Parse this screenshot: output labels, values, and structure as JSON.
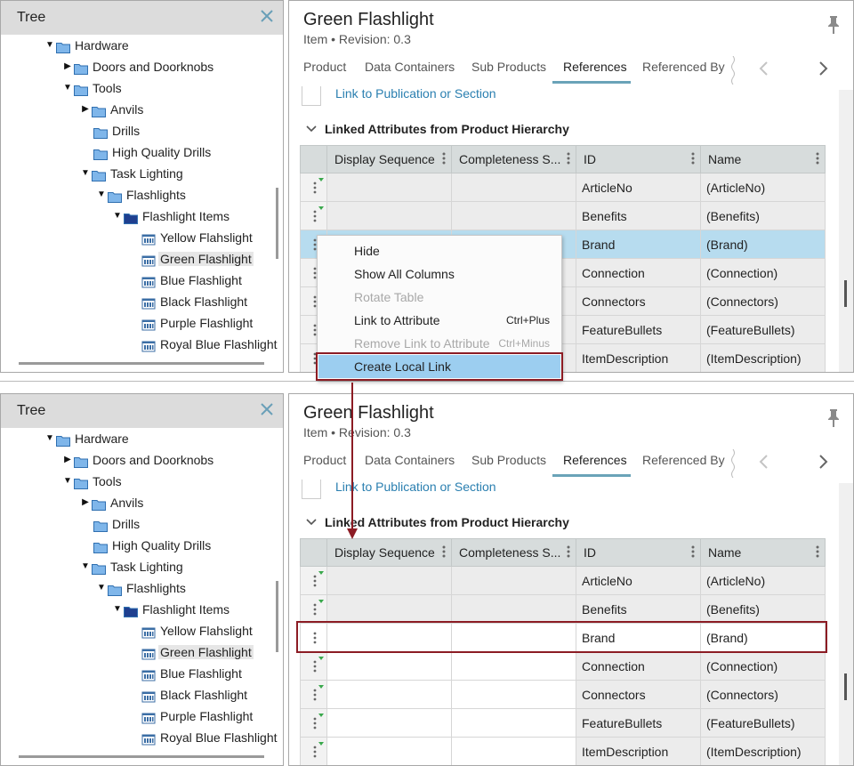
{
  "tree": {
    "title": "Tree",
    "items": [
      {
        "label": "Hardware",
        "arrow": "down",
        "folder": "open"
      },
      {
        "label": "Doors and Doorknobs",
        "arrow": "right",
        "folder": "closed"
      },
      {
        "label": "Tools",
        "arrow": "down",
        "folder": "open"
      },
      {
        "label": "Anvils",
        "arrow": "right",
        "folder": "closed"
      },
      {
        "label": "Drills",
        "arrow": "",
        "folder": "closed"
      },
      {
        "label": "High Quality Drills",
        "arrow": "",
        "folder": "closed"
      },
      {
        "label": "Task Lighting",
        "arrow": "down",
        "folder": "open"
      },
      {
        "label": "Flashlights",
        "arrow": "down",
        "folder": "open"
      },
      {
        "label": "Flashlight Items",
        "arrow": "down",
        "folder": "dark"
      },
      {
        "label": "Yellow Flahslight",
        "arrow": "",
        "folder": "product"
      },
      {
        "label": "Green Flashlight",
        "arrow": "",
        "folder": "product",
        "selected": true
      },
      {
        "label": "Blue Flashlight",
        "arrow": "",
        "folder": "product"
      },
      {
        "label": "Black Flashlight",
        "arrow": "",
        "folder": "product"
      },
      {
        "label": "Purple Flashlight",
        "arrow": "",
        "folder": "product"
      },
      {
        "label": "Royal Blue Flashlight",
        "arrow": "",
        "folder": "product"
      }
    ]
  },
  "item": {
    "title": "Green Flashlight",
    "type": "Item",
    "revision": "Revision: 0.3"
  },
  "tabs": [
    "Product",
    "Data Containers",
    "Sub Products",
    "References",
    "Referenced By"
  ],
  "active_tab": "References",
  "content": {
    "link_publication": "Link to Publication or Section",
    "section_title": "Linked Attributes from Product Hierarchy",
    "columns": [
      "Display Sequence",
      "Completeness S...",
      "ID",
      "Name"
    ],
    "rows": [
      {
        "id": "ArticleNo",
        "name": "(ArticleNo)"
      },
      {
        "id": "Benefits",
        "name": "(Benefits)"
      },
      {
        "id": "Brand",
        "name": "(Brand)"
      },
      {
        "id": "Connection",
        "name": "(Connection)"
      },
      {
        "id": "Connectors",
        "name": "(Connectors)"
      },
      {
        "id": "FeatureBullets",
        "name": "(FeatureBullets)"
      },
      {
        "id": "ItemDescription",
        "name": "(ItemDescription)"
      }
    ]
  },
  "context_menu": {
    "items": [
      {
        "label": "Hide",
        "shortcut": "",
        "disabled": false
      },
      {
        "label": "Show All Columns",
        "shortcut": "",
        "disabled": false
      },
      {
        "label": "Rotate Table",
        "shortcut": "",
        "disabled": true
      },
      {
        "label": "Link to Attribute",
        "shortcut": "Ctrl+Plus",
        "disabled": false
      },
      {
        "label": "Remove Link to Attribute",
        "shortcut": "Ctrl+Minus",
        "disabled": true
      },
      {
        "label": "Create Local Link",
        "shortcut": "",
        "disabled": false,
        "active": true
      }
    ]
  },
  "colors": {
    "accent": "#6aa3b8",
    "highlight_row": "#b7dcef",
    "menu_active": "#9ccef0",
    "callout": "#8c1c24",
    "folder": "#7fb6ea",
    "folder_dark": "#1f3f8f"
  }
}
